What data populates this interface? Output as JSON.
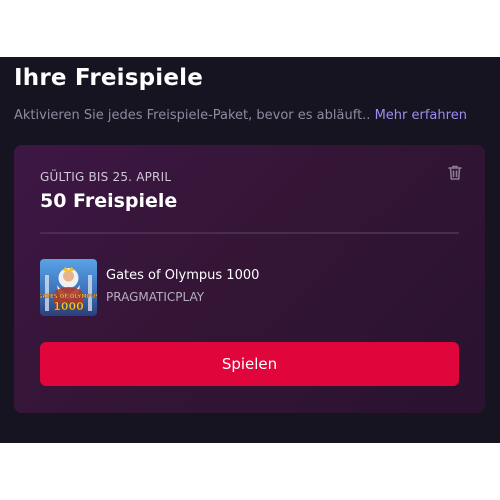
{
  "header": {
    "title": "Ihre Freispiele",
    "subtitle": "Aktivieren Sie jedes Freispiele-Paket, bevor es abläuft..",
    "learn_more": "Mehr erfahren"
  },
  "package": {
    "valid_until": "GÜLTIG BIS 25. APRIL",
    "offer": "50 Freispiele",
    "delete_icon": "trash-icon",
    "game": {
      "name": "Gates of Olympus 1000",
      "provider": "PRAGMATICPLAY",
      "thumbnail_text": "GATES OF OLYMPUS 1000"
    },
    "play_label": "Spielen"
  },
  "colors": {
    "accent": "#e0063c",
    "link": "#9e8df0",
    "panel_bg": "#171421",
    "card_bg": "#3a1642"
  }
}
